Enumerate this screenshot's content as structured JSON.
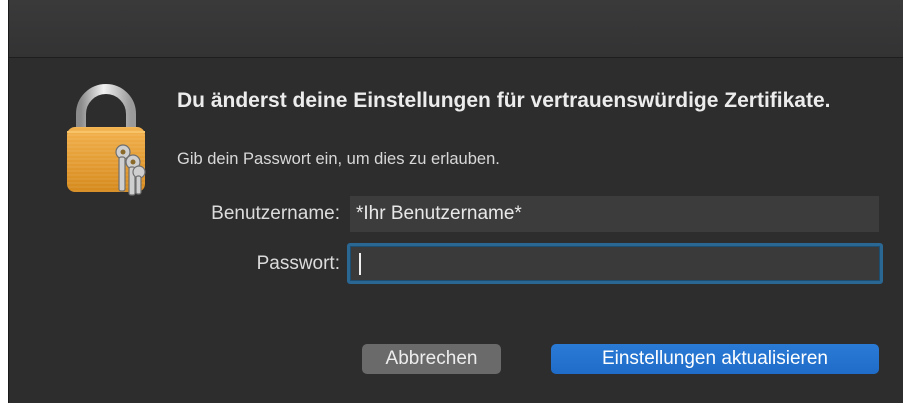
{
  "dialog": {
    "heading": "Du änderst deine Einstellungen für vertrauenswürdige Zertifikate.",
    "subtext": "Gib dein Passwort ein, um dies zu erlauben.",
    "icon": "padlock-with-keys-icon"
  },
  "form": {
    "username_label": "Benutzername:",
    "username_value": "*Ihr Benutzername*",
    "password_label": "Passwort:",
    "password_value": ""
  },
  "buttons": {
    "cancel_label": "Abbrechen",
    "confirm_label": "Einstellungen aktualisieren"
  },
  "colors": {
    "dialog_bg": "#2d2d2e",
    "accent": "#2a7bd6",
    "focus_ring": "#2a6792"
  }
}
